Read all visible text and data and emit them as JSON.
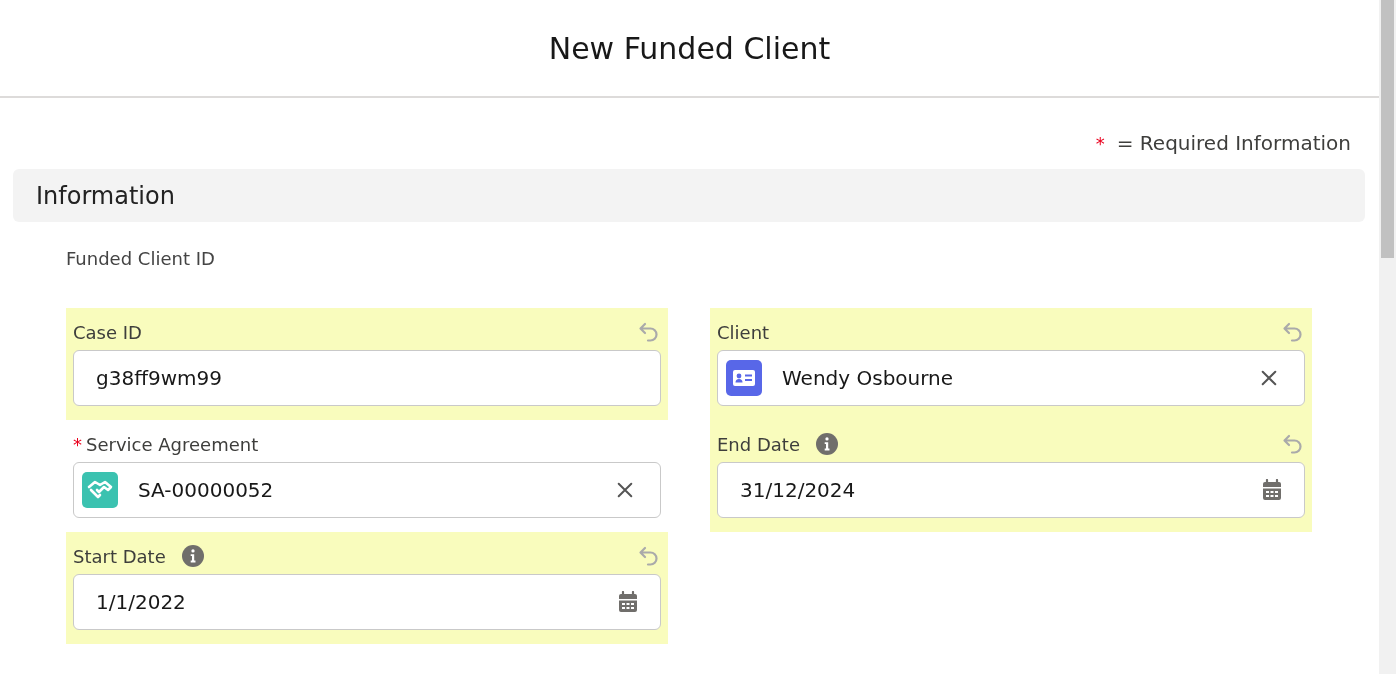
{
  "header": {
    "title": "New Funded Client"
  },
  "legend": {
    "mark": "*",
    "text": "= Required Information"
  },
  "section": {
    "title": "Information"
  },
  "read_only_label": "Funded Client ID",
  "columns": [
    [
      {
        "kind": "text",
        "label": "Case ID",
        "value": "g38ff9wm99",
        "changed": true,
        "has_info": false
      },
      {
        "kind": "agreement_lookup",
        "label": "Service Agreement",
        "required_mark": "*",
        "value": "SA-00000052",
        "changed": false,
        "has_info": false
      },
      {
        "kind": "date",
        "label": "Start Date",
        "value": "1/1/2022",
        "changed": true,
        "has_info": true
      }
    ],
    [
      {
        "kind": "contact_lookup",
        "label": "Client",
        "value": "Wendy Osbourne",
        "changed": true,
        "has_info": false
      },
      {
        "kind": "date",
        "label": "End Date",
        "value": "31/12/2024",
        "changed": true,
        "has_info": true
      }
    ]
  ]
}
